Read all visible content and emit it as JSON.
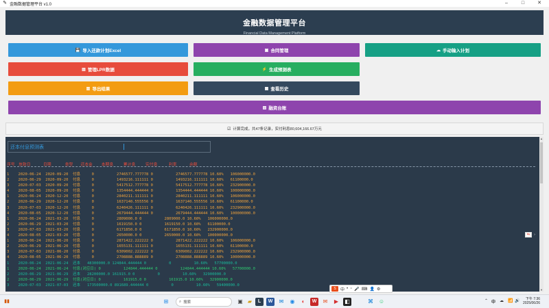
{
  "window": {
    "title": "金融数据管理平台 v1.0",
    "controls": [
      "–",
      "□",
      "✕"
    ]
  },
  "header": {
    "title": "金融数据管理平台",
    "subtitle": "Financial Data Management Platform"
  },
  "buttons": [
    {
      "key": "import",
      "label": "导入还款计划Excel",
      "icon": "💾",
      "color": "#3498db"
    },
    {
      "key": "contract",
      "label": "合同管理",
      "icon": "▣",
      "color": "#8e44ad"
    },
    {
      "key": "manual",
      "label": "手动输入计划",
      "icon": "☁",
      "color": "#16a085"
    },
    {
      "key": "lpr",
      "label": "管理LPR数据",
      "icon": "▤",
      "color": "#e74c3c"
    },
    {
      "key": "forecast",
      "label": "生成预测表",
      "icon": "⚡",
      "color": "#27ae60"
    },
    {
      "key": "export",
      "label": "导出结果",
      "icon": "▥",
      "color": "#f39c12"
    },
    {
      "key": "history",
      "label": "查看历史",
      "icon": "▦",
      "color": "#34495e"
    },
    {
      "key": "ledger",
      "label": "融资台账",
      "icon": "▧",
      "color": "#8e44ad"
    }
  ],
  "status": {
    "icon": "☑",
    "text": "计算完成，共47条记录，实付利息80,604,166.67万元"
  },
  "panel": {
    "title": "还本付息预测表",
    "header_line": "序号   放款日          日期           类型      还本金       本期息        累计息        实付息         利率          余额",
    "rows": [
      {
        "c": "o",
        "t": "1    2020-06-24  2020-09-20  付息     0          2746577.777778 0          2746577.777778 10.60%   106000000.0"
      },
      {
        "c": "o",
        "t": "2    2020-06-29  2020-09-20  付息     0          1493216.111111 0          1493216.111111 10.60%   61100000.0"
      },
      {
        "c": "o",
        "t": "3    2020-07-03  2020-09-20  付息     0          5417512.777778 0          5417512.777778 10.60%   232900000.0"
      },
      {
        "c": "o",
        "t": "4    2020-08-05  2020-09-20  付息     0          1354444.444444 0          1354444.444444 10.60%   100000000.0"
      },
      {
        "c": "o",
        "t": "1    2020-06-24  2020-12-20  付息     0          2840211.111111 0          2840211.111111 10.60%   106000000.0"
      },
      {
        "c": "o",
        "t": "2    2020-06-29  2020-12-20  付息     0          1637140.555556 0          1637140.555556 10.60%   61100000.0"
      },
      {
        "c": "o",
        "t": "3    2020-07-03  2020-12-20  付息     0          6240426.111111 0          6240426.111111 10.60%   232900000.0"
      },
      {
        "c": "o",
        "t": "4    2020-08-05  2020-12-20  付息     0          2679444.444444 0          2679444.444444 10.60%   100000000.0"
      },
      {
        "c": "o",
        "t": "1    2020-06-24  2021-03-20  付息     0          2809000.0 0          2809000.0 10.60%   106000000.0"
      },
      {
        "c": "o",
        "t": "2    2020-06-29  2021-03-20  付息     0          1619150.0 0          1619150.0 10.60%   61100000.0"
      },
      {
        "c": "o",
        "t": "3    2020-07-03  2021-03-20  付息     0          6171850.0 0          6171850.0 10.60%   232900000.0"
      },
      {
        "c": "o",
        "t": "4    2020-08-05  2021-03-20  付息     0          2650000.0 0          2650000.0 10.60%   100000000.0"
      },
      {
        "c": "o",
        "t": "1    2020-06-24  2021-06-20  付息     0          2871422.222222 0          2871422.222222 10.60%   106000000.0"
      },
      {
        "c": "o",
        "t": "2    2020-06-29  2021-06-20  付息     0          1655131.111111 0          1655131.111111 10.60%   61100000.0"
      },
      {
        "c": "o",
        "t": "3    2020-07-03  2021-06-20  付息     0          6309002.222222 0          6309002.222222 10.60%   232900000.0"
      },
      {
        "c": "o",
        "t": "4    2020-08-05  2021-06-20  付息     0          2708888.888889 0          2708888.888889 10.60%   100000000.0"
      },
      {
        "c": "t",
        "t": "1    2020-06-24  2021-06-24  还本   48300000.0 124844.444444 0          0          10.60%   57700000.0"
      },
      {
        "c": "g",
        "t": "1    2020-06-24  2021-06-24  付息(对应日) 0          124844.444444 0          124844.444444 10.60%   57700000.0"
      },
      {
        "c": "t",
        "t": "2    2020-06-29  2021-06-29  还本   28200000.0 161915.0 0          0          10.60%   32900000.0"
      },
      {
        "c": "g",
        "t": "2    2020-06-29  2021-06-29  付息(对应日) 0          161915.0 0          161915.0 10.60%   32900000.0"
      },
      {
        "c": "t",
        "t": "3    2020-07-03  2021-07-03  还本   173500000.0 891689.444444 0          0          10.60%   59400000.0"
      }
    ]
  },
  "tray": {
    "ime_items": [
      "中",
      "•",
      "⁼",
      "🎤",
      "⌨",
      "👤",
      "⚙"
    ],
    "search_placeholder": "搜索",
    "time": "下午 7:36",
    "date": "2025/06/26",
    "lang": "中",
    "tray_icons": [
      "⌃",
      "☁",
      "📶",
      "🔊",
      "🔋"
    ]
  },
  "taskbar_apps": [
    "⊞",
    "▣",
    "▰",
    "L",
    "W",
    "✉",
    "◉",
    "◐",
    "W",
    "✉",
    "▶",
    "◧",
    "⌘",
    "☺"
  ]
}
